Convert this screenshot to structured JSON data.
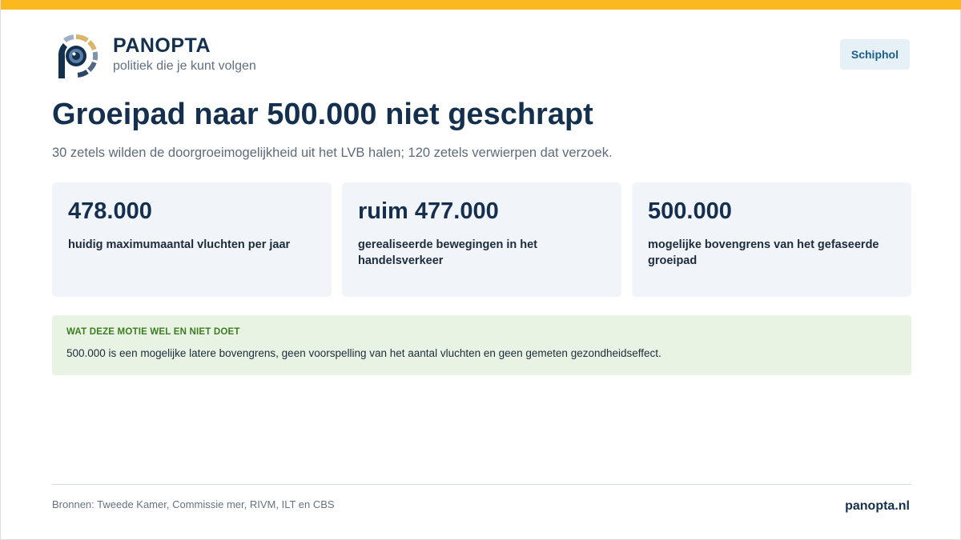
{
  "brand": {
    "name": "PANOPTA",
    "tagline": "politiek die je kunt volgen"
  },
  "topic": {
    "label": "Schiphol"
  },
  "headline": "Groeipad naar 500.000 niet geschrapt",
  "subline": "30 zetels wilden de doorgroeimogelijkheid uit het LVB halen; 120 zetels verwierpen dat verzoek.",
  "stats": [
    {
      "value": "478.000",
      "label": "huidig maximumaantal vluchten per jaar"
    },
    {
      "value": "ruim 477.000",
      "label": "gerealiseerde bewegingen in het handelsverkeer"
    },
    {
      "value": "500.000",
      "label": "mogelijke bovengrens van het gefaseerde groeipad"
    }
  ],
  "notice": {
    "title": "WAT DEZE MOTIE WEL EN NIET DOET",
    "body": "500.000 is een mogelijke latere bovengrens, geen voorspelling van het aantal vluchten en geen gemeten gezondheidseffect."
  },
  "footer": {
    "sources": "Bronnen: Tweede Kamer, Commissie mer, RIVM, ILT en CBS",
    "site": "panopta.nl"
  },
  "colors": {
    "accent_bar": "#fbb91f",
    "navy": "#14304e",
    "chip_bg": "#e6f0f7",
    "chip_text": "#1a5f8a",
    "card_bg": "#f1f4f8",
    "notice_bg": "#e8f3e3",
    "notice_title": "#3c7e1f"
  },
  "icons": {
    "logo": "panopta-eye-logo-icon"
  }
}
